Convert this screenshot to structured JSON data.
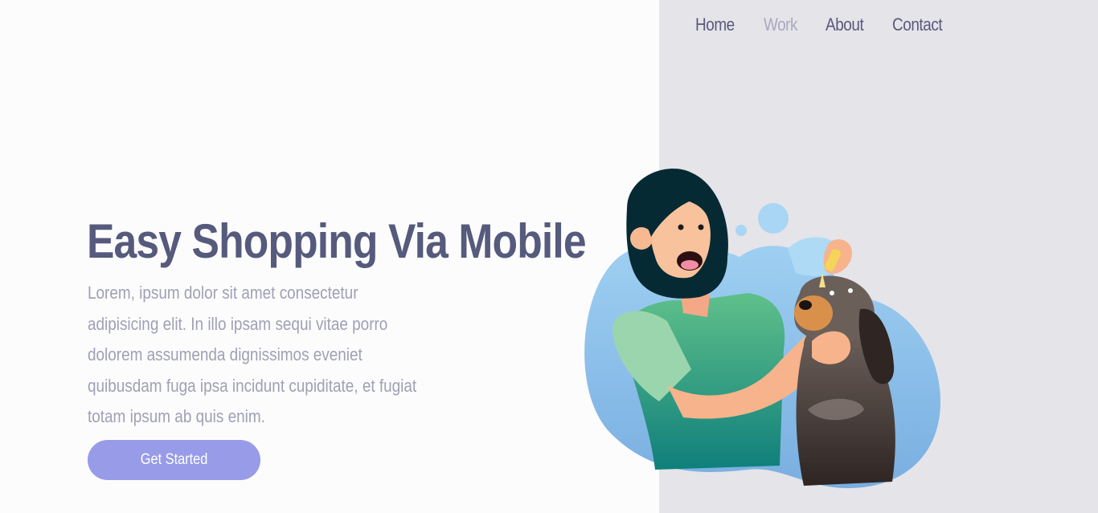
{
  "nav": {
    "items": [
      {
        "label": "Home",
        "active": false
      },
      {
        "label": "Work",
        "active": true
      },
      {
        "label": "About",
        "active": false
      },
      {
        "label": "Contact",
        "active": false
      }
    ]
  },
  "hero": {
    "title": "Easy Shopping Via Mobile",
    "description": "Lorem, ipsum dolor sit amet consectetur adipisicing elit. In illo ipsam sequi vitae porro dolorem assumenda dignissimos eveniet quibusdam fuga ipsa incidunt cupiditate, et fugiat totam ipsum ab quis enim.",
    "cta_label": "Get Started"
  },
  "colors": {
    "title": "#565a7c",
    "body_text": "#9fa0b4",
    "button": "#979be8",
    "right_panel": "#e5e4e9",
    "nav_active": "#a9a8bf"
  }
}
